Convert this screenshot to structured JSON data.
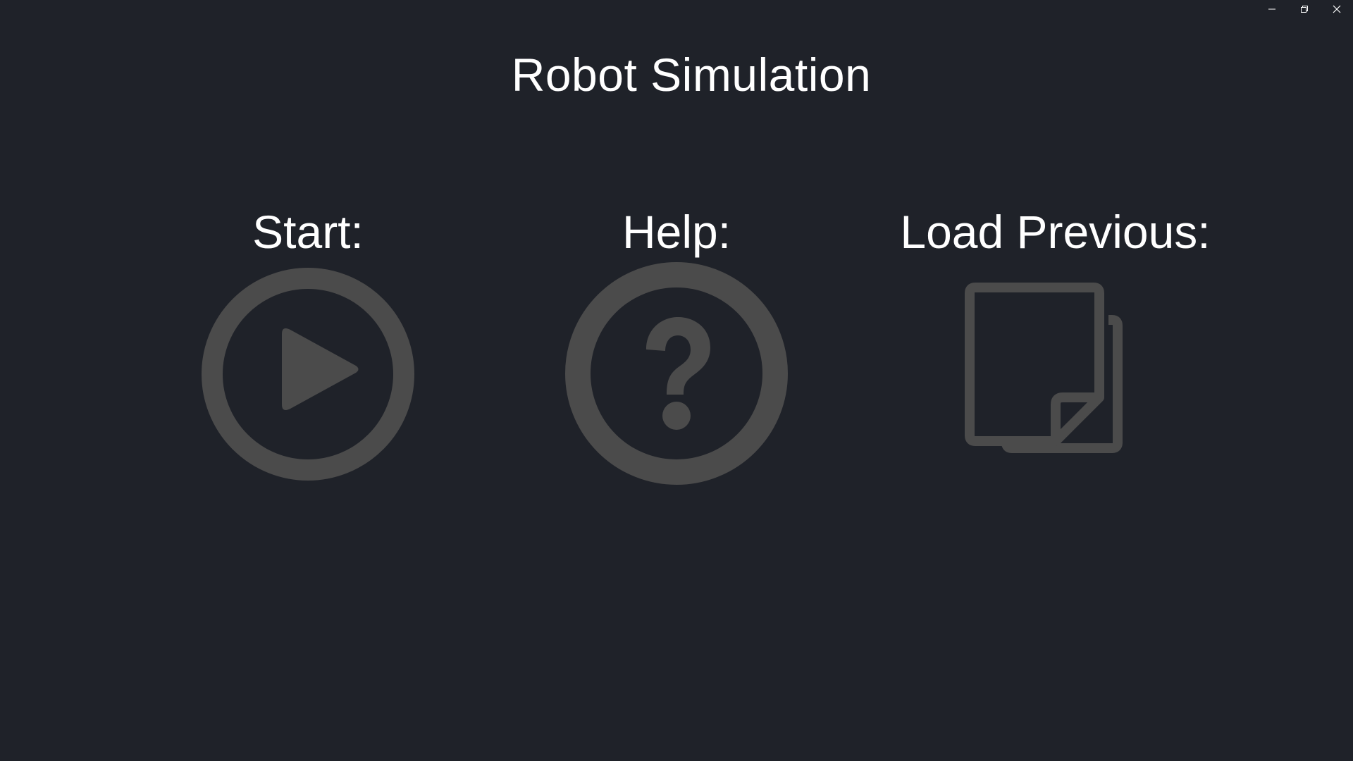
{
  "window": {
    "controls": {
      "minimize_icon": "minimize-icon",
      "restore_icon": "restore-icon",
      "close_icon": "close-icon"
    }
  },
  "app": {
    "title": "Robot Simulation"
  },
  "options": {
    "start": {
      "label": "Start:",
      "icon": "play-circle-icon"
    },
    "help": {
      "label": "Help:",
      "icon": "question-circle-icon"
    },
    "load": {
      "label": "Load Previous:",
      "icon": "documents-copy-icon"
    }
  },
  "colors": {
    "background": "#1f2229",
    "icon": "#4b4b4b",
    "text": "#ffffff"
  }
}
